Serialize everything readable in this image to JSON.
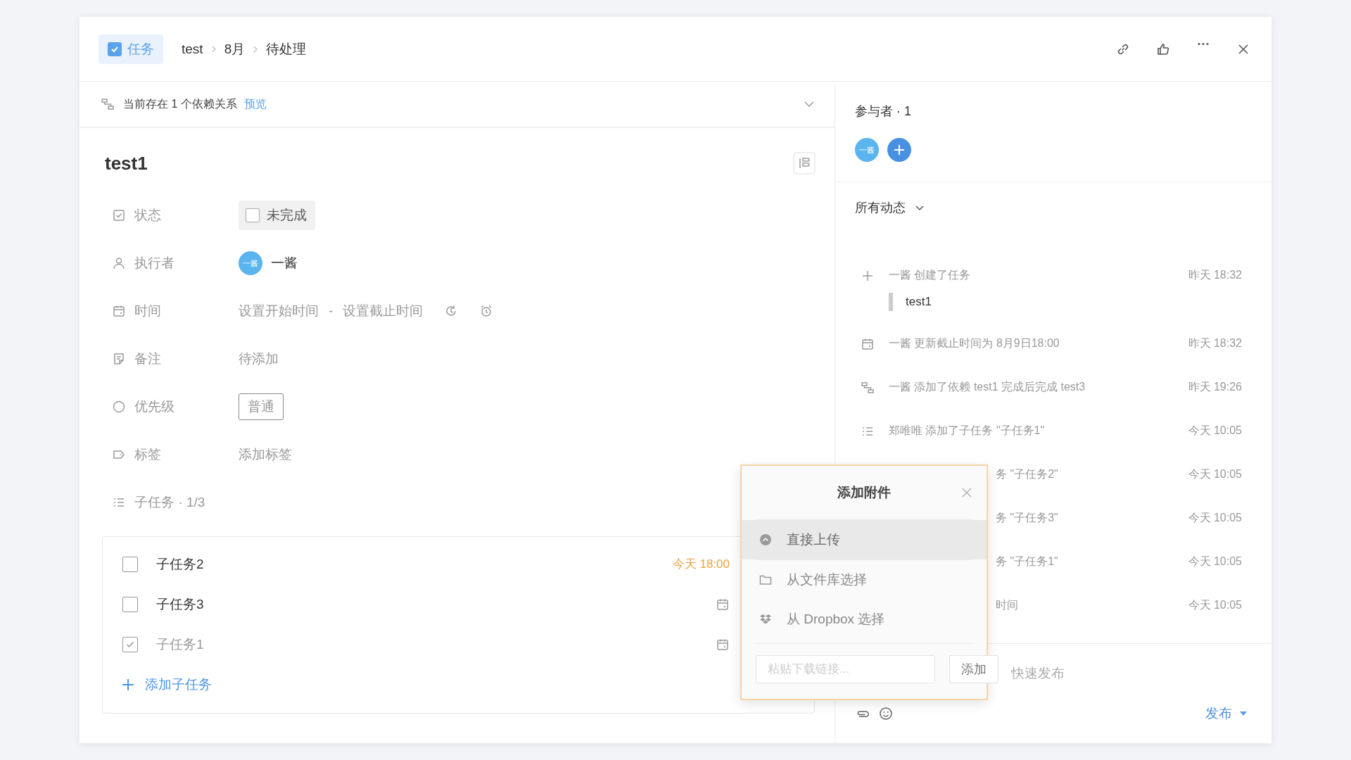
{
  "header": {
    "type_tag": {
      "label": "任务",
      "checked": true
    },
    "breadcrumb": [
      "test",
      "8月",
      "待处理"
    ]
  },
  "dependency_bar": {
    "text": "当前存在 1 个依赖关系",
    "link": "预览"
  },
  "task": {
    "title": "test1",
    "fields": [
      {
        "kind": "status",
        "label": "状态",
        "value": "未完成",
        "checked": false
      },
      {
        "kind": "assignee",
        "label": "执行者",
        "avatar": "一酱",
        "value": "一酱"
      },
      {
        "kind": "time",
        "label": "时间",
        "start": "设置开始时间",
        "separator": "-",
        "end": "设置截止时间"
      },
      {
        "kind": "note",
        "label": "备注",
        "value": "待添加"
      },
      {
        "kind": "priority",
        "label": "优先级",
        "value": "普通"
      },
      {
        "kind": "tags",
        "label": "标签",
        "value": "添加标签"
      }
    ],
    "subtasks": {
      "label": "子任务 · 1/3",
      "items": [
        {
          "title": "子任务2",
          "checked": false,
          "due": "今天 18:00"
        },
        {
          "title": "子任务3",
          "checked": false
        },
        {
          "title": "子任务1",
          "checked": true
        }
      ],
      "add": "添加子任务"
    }
  },
  "participants": {
    "title": "参与者 · 1",
    "members": [
      {
        "avatar": "一酱"
      }
    ]
  },
  "activity": {
    "filter": "所有动态",
    "items": [
      {
        "kind": "create",
        "text": "一酱 创建了任务",
        "quote": "test1",
        "time": "昨天 18:32"
      },
      {
        "kind": "due",
        "text": "一酱 更新截止时间为 8月9日18:00",
        "time": "昨天 18:32"
      },
      {
        "kind": "dependency",
        "text": "一酱 添加了依赖 test1 完成后完成 test3",
        "time": "昨天 19:26"
      },
      {
        "kind": "subtask",
        "text": "郑唯唯 添加了子任务 \"子任务1\"",
        "time": "今天 10:05"
      },
      {
        "kind": "covered",
        "text": "务 \"子任务2\"",
        "time": "今天 10:05"
      },
      {
        "kind": "covered",
        "text": "务 \"子任务3\"",
        "time": "今天 10:05"
      },
      {
        "kind": "covered",
        "text": "务 \"子任务1\"",
        "time": "今天 10:05"
      },
      {
        "kind": "covered",
        "text": "时间",
        "time": "今天 10:05"
      }
    ]
  },
  "composer": {
    "placeholder": "快速发布",
    "publish": "发布"
  },
  "popup": {
    "title": "添加附件",
    "options": [
      {
        "kind": "upload",
        "label": "直接上传",
        "selected": true
      },
      {
        "kind": "library",
        "label": "从文件库选择",
        "selected": false
      },
      {
        "kind": "dropbox",
        "label": "从 Dropbox 选择",
        "selected": false
      }
    ],
    "link_placeholder": "粘贴下载链接...",
    "add": "添加"
  }
}
